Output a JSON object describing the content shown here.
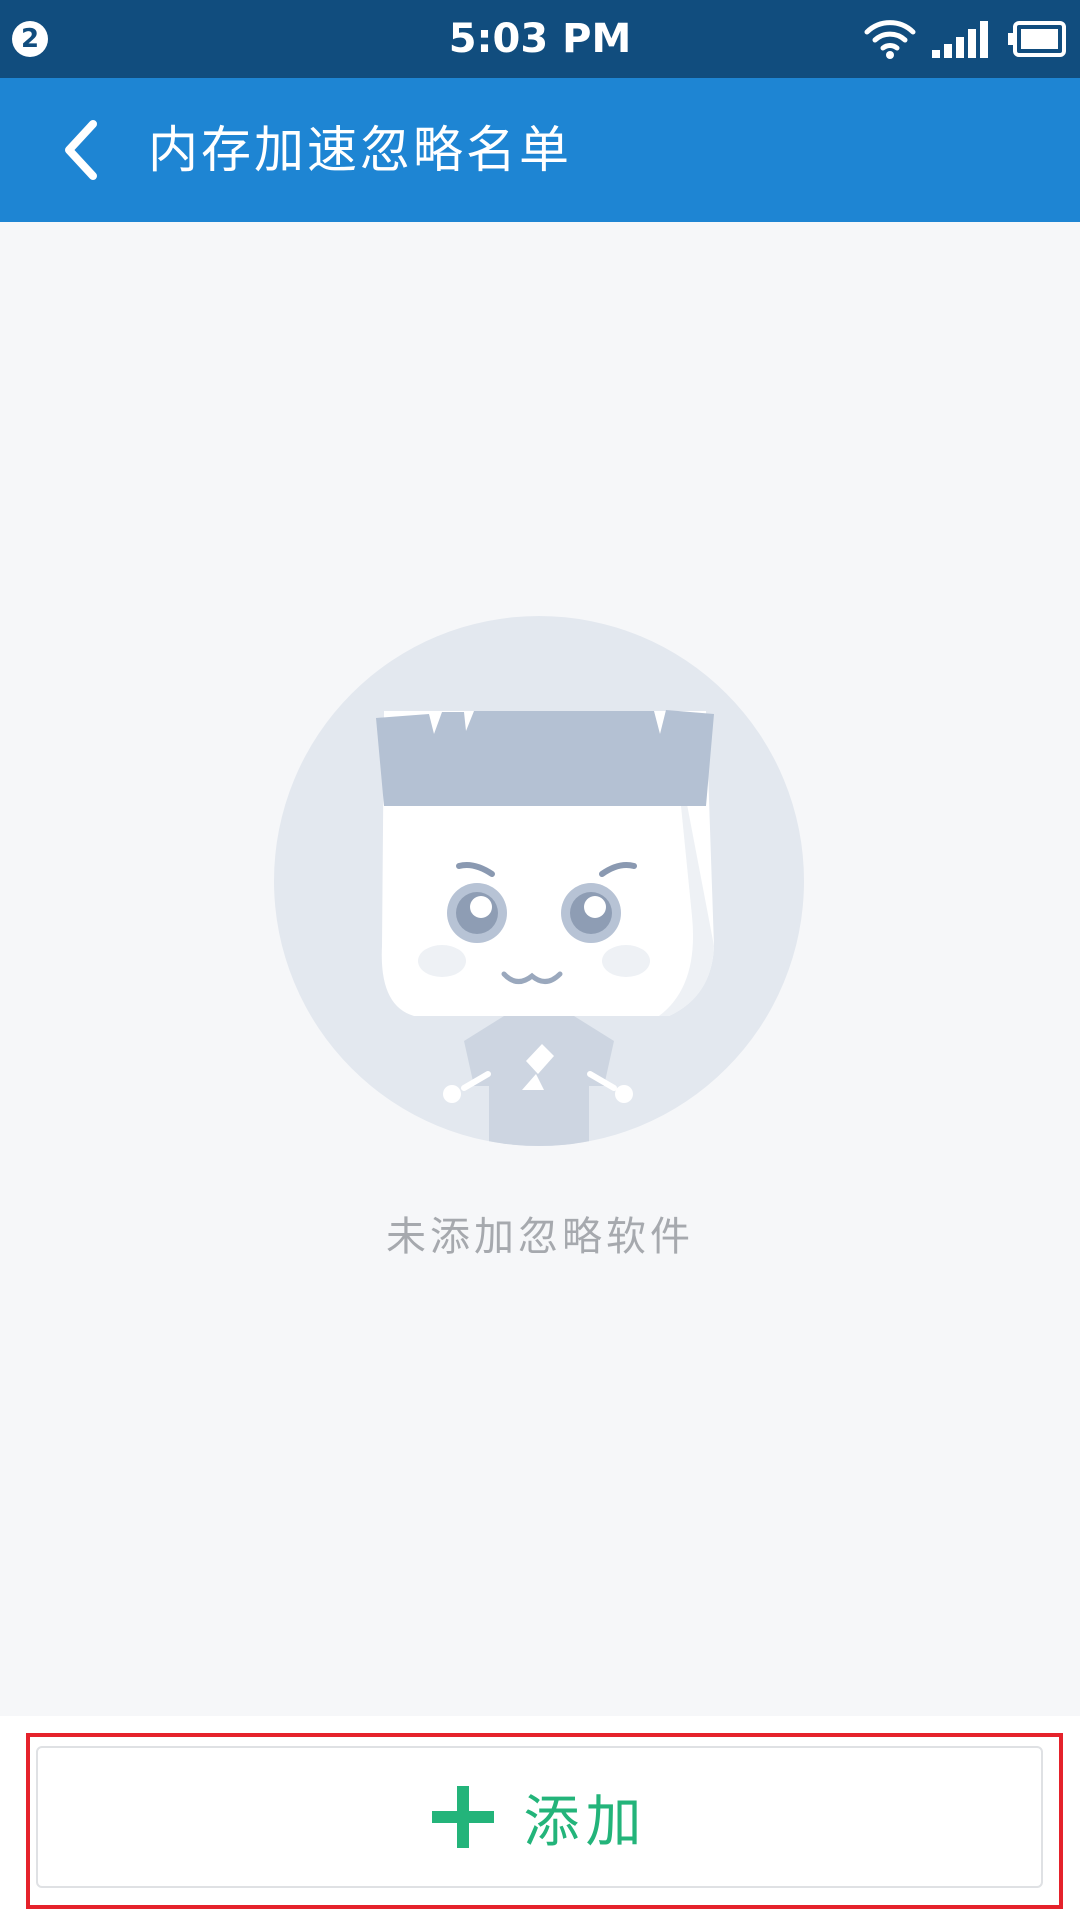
{
  "status_bar": {
    "notification_count": "2",
    "time": "5:03 PM"
  },
  "header": {
    "title": "内存加速忽略名单",
    "back_icon": "chevron-left-icon"
  },
  "empty_state": {
    "message": "未添加忽略软件",
    "illustration": "mascot-illustration"
  },
  "footer": {
    "add_label": "添加",
    "add_icon": "plus-icon"
  },
  "colors": {
    "status_bar": "#114d7e",
    "app_bar": "#1e85d3",
    "background": "#f6f7f9",
    "accent_green": "#23b47a",
    "highlight_red": "#e5222b",
    "muted_text": "#a6a9ae"
  }
}
